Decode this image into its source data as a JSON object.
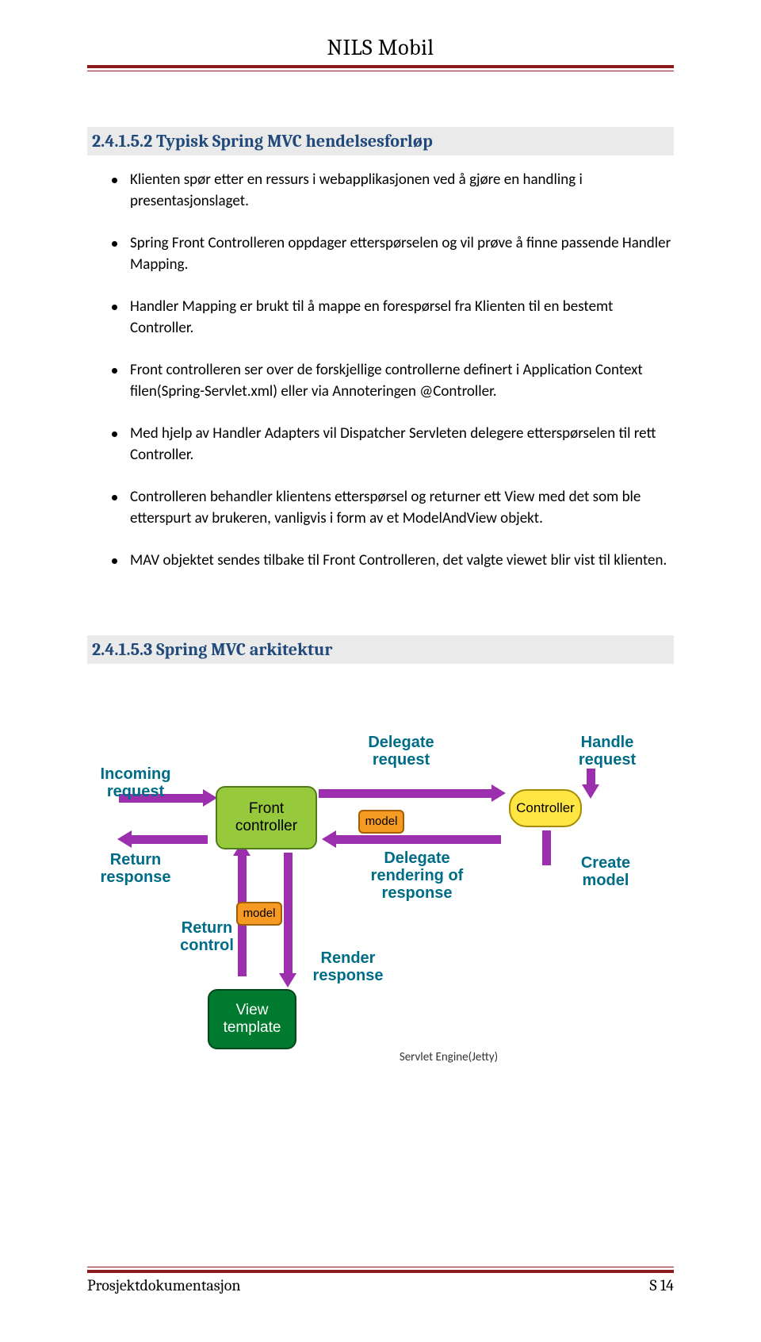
{
  "header": {
    "title": "NILS Mobil"
  },
  "section1": {
    "heading": "2.4.1.5.2 Typisk Spring MVC hendelsesforløp",
    "bullets": [
      "Klienten spør etter en ressurs i webapplikasjonen ved å gjøre en handling i presentasjonslaget.",
      "Spring Front Controlleren oppdager etterspørselen og vil prøve å finne passende Handler Mapping.",
      "Handler Mapping er brukt til å mappe en forespørsel fra Klienten til en bestemt Controller.",
      "Front controlleren ser over de forskjellige controllerne definert i Application Context filen(Spring-Servlet.xml) eller via Annoteringen @Controller.",
      "Med hjelp av Handler Adapters vil Dispatcher Servleten delegere etterspørselen til rett Controller.",
      "Controlleren behandler klientens etterspørsel og returner ett View med det som ble etterspurt av brukeren, vanligvis i form av et ModelAndView objekt.",
      "MAV objektet sendes tilbake til Front Controlleren, det valgte viewet blir vist til klienten."
    ]
  },
  "section2": {
    "heading": "2.4.1.5.3 Spring MVC arkitektur"
  },
  "diagram": {
    "boxes": {
      "front": "Front controller",
      "controller": "Controller",
      "view": "View template",
      "model1": "model",
      "model2": "model"
    },
    "labels": {
      "incoming": "Incoming request",
      "returnResponse": "Return response",
      "delegateRequest": "Delegate request",
      "handleRequest": "Handle request",
      "delegateRender": "Delegate rendering of response",
      "createModel": "Create model",
      "returnControl": "Return control",
      "renderResponse": "Render response",
      "servletEngine": "Servlet Engine(Jetty)"
    }
  },
  "footer": {
    "left": "Prosjektdokumentasjon",
    "right": "S 14"
  }
}
